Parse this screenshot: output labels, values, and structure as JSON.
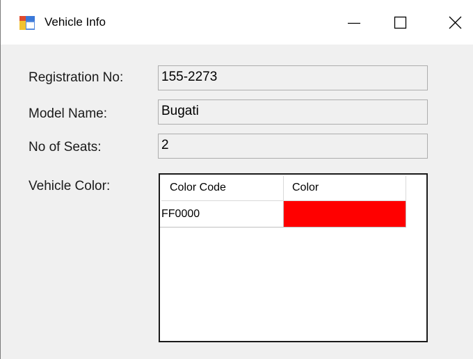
{
  "window": {
    "title": "Vehicle Info",
    "icon": "windows-forms-app-icon",
    "minimize_icon": "minimize-icon",
    "maximize_icon": "maximize-icon",
    "close_icon": "close-icon"
  },
  "form": {
    "registration_label": "Registration No:",
    "registration_value": "155-2273",
    "model_label": "Model Name:",
    "model_value": "Bugati",
    "seats_label": "No of Seats:",
    "seats_value": "2",
    "color_label": "Vehicle Color:"
  },
  "grid": {
    "columns": [
      "Color Code",
      "Color"
    ],
    "rows": [
      {
        "code": "FF0000",
        "swatch": "#FF0000"
      }
    ]
  }
}
